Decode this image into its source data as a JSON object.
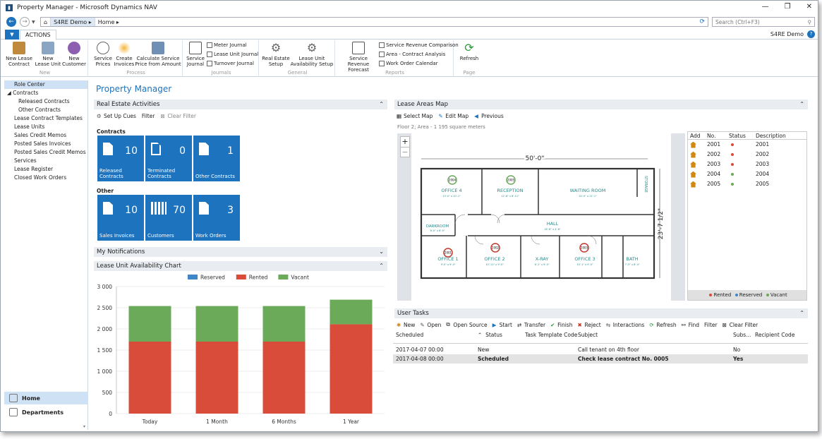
{
  "window": {
    "title": "Property Manager - Microsoft Dynamics NAV",
    "controls": [
      "—",
      "❐",
      "✕"
    ]
  },
  "nav": {
    "crumbs": [
      "S4RE Demo",
      "Home"
    ],
    "search_placeholder": "Search (Ctrl+F3)"
  },
  "ribbon": {
    "tab": "ACTIONS",
    "user": "S4RE Demo",
    "groups": [
      {
        "name": "New",
        "buttons": [
          {
            "label": "New Lease\nContract"
          },
          {
            "label": "New\nLease Unit"
          },
          {
            "label": "New\nCustomer"
          }
        ]
      },
      {
        "name": "Process",
        "buttons": [
          {
            "label": "Service\nPrices"
          },
          {
            "label": "Create\nInvoices"
          },
          {
            "label": "Calculate Service\nPrice from Amount"
          }
        ]
      },
      {
        "name": "Journals",
        "buttons": [
          {
            "label": "Service\nJournal"
          }
        ],
        "small": [
          "Meter Journal",
          "Lease Unit Journal",
          "Turnover Journal"
        ]
      },
      {
        "name": "General",
        "buttons": [
          {
            "label": "Real Estate\nSetup"
          },
          {
            "label": "Lease Unit\nAvailability Setup"
          }
        ]
      },
      {
        "name": "Reports",
        "buttons": [
          {
            "label": "Service Revenue\nForecast"
          }
        ],
        "small": [
          "Service Revenue Comparison",
          "Area - Contract Analysis",
          "Work Order Calendar"
        ]
      },
      {
        "name": "Page",
        "buttons": [
          {
            "label": "Refresh"
          }
        ]
      }
    ]
  },
  "sidebar": {
    "items": [
      "Role Center",
      "Contracts",
      "Released Contracts",
      "Other Contracts",
      "Lease Contract Templates",
      "Lease Units",
      "Sales Credit Memos",
      "Posted Sales Invoices",
      "Posted Sales Credit Memos",
      "Services",
      "Lease Register",
      "Closed Work Orders"
    ],
    "bottom": [
      "Home",
      "Departments"
    ]
  },
  "page": {
    "title": "Property Manager"
  },
  "activities": {
    "header": "Real Estate Activities",
    "actions": [
      "Set Up Cues",
      "Filter",
      "Clear Filter"
    ],
    "group1": "Contracts",
    "group2": "Other",
    "tiles1": [
      {
        "num": "10",
        "label": "Released\nContracts"
      },
      {
        "num": "0",
        "label": "Terminated\nContracts"
      },
      {
        "num": "1",
        "label": "Other Contracts"
      }
    ],
    "tiles2": [
      {
        "num": "10",
        "label": "Sales Invoices"
      },
      {
        "num": "70",
        "label": "Customers"
      },
      {
        "num": "3",
        "label": "Work Orders"
      }
    ]
  },
  "notifications": {
    "header": "My Notifications"
  },
  "chart_data": {
    "type": "bar",
    "title": "Lease Unit Availability Chart",
    "categories": [
      "Today",
      "1 Month",
      "6 Months",
      "1 Year"
    ],
    "series": [
      {
        "name": "Reserved",
        "color": "#3e86c8",
        "values": [
          0,
          0,
          0,
          0
        ]
      },
      {
        "name": "Rented",
        "color": "#d94c3a",
        "values": [
          1700,
          1700,
          1700,
          2110
        ]
      },
      {
        "name": "Vacant",
        "color": "#6aaa58",
        "values": [
          840,
          840,
          840,
          580
        ]
      }
    ],
    "ylim": [
      0,
      3000
    ],
    "yticks": [
      "0",
      "500",
      "1 000",
      "1 500",
      "2 000",
      "2 500",
      "3 000"
    ],
    "legend": "top",
    "grid": true
  },
  "map": {
    "header": "Lease Areas Map",
    "actions": [
      "Select Map",
      "Edit Map",
      "Previous"
    ],
    "info": "Floor 2; Area - 1 195 square meters",
    "dim_top": "50'-0\"",
    "dim_side": "23'-7 1/2\"",
    "rooms": [
      {
        "name": "OFFICE 4",
        "size": "13'-0\" x 10'-1\""
      },
      {
        "name": "RECEPTION",
        "size": "12'-6\" x 8'-11\""
      },
      {
        "name": "WAITING ROOM",
        "size": "20'-0\" x 11'-1\""
      },
      {
        "name": "DARKROOM",
        "size": "6'-0\" x 8'-0\""
      },
      {
        "name": "HALL",
        "size": "45'-6\" x 4'-6\""
      },
      {
        "name": "OFFICE 1",
        "size": "9'-0\" x 9'-0\""
      },
      {
        "name": "OFFICE 2",
        "size": "10'-11\" x 9'-0\""
      },
      {
        "name": "X-RAY",
        "size": "8'-1\" x 9'-0\""
      },
      {
        "name": "OFFICE 3",
        "size": "10'-1\" x 9'-0\""
      },
      {
        "name": "BATH",
        "size": "7'-5\" x 8'-4\""
      },
      {
        "name": "STORAGE",
        "size": ""
      }
    ],
    "markers": [
      "2004",
      "2001",
      "2002",
      "2003",
      "2005"
    ],
    "grid": {
      "headers": [
        "Add",
        "No.",
        "Status",
        "Description"
      ],
      "rows": [
        {
          "no": "2001",
          "status": "#d94c3a",
          "desc": "2001"
        },
        {
          "no": "2002",
          "status": "#d94c3a",
          "desc": "2002"
        },
        {
          "no": "2003",
          "status": "#d94c3a",
          "desc": "2003"
        },
        {
          "no": "2004",
          "status": "#6aaa58",
          "desc": "2004"
        },
        {
          "no": "2005",
          "status": "#6aaa58",
          "desc": "2005"
        }
      ]
    },
    "legend": [
      "Rented",
      "Reserved",
      "Vacant"
    ]
  },
  "tasks": {
    "header": "User Tasks",
    "actions": [
      "New",
      "Open",
      "Open Source",
      "Start",
      "Transfer",
      "Finish",
      "Reject",
      "Interactions",
      "Refresh",
      "Find",
      "Filter",
      "Clear Filter"
    ],
    "columns": [
      "Scheduled",
      "Status",
      "Task Template Code",
      "Subject",
      "Subs...",
      "Recipient Code"
    ],
    "rows": [
      {
        "scheduled": "2017-04-07 00:00",
        "status": "New",
        "tpl": "",
        "subject": "Call tenant on 4th floor",
        "subs": "No",
        "rc": ""
      },
      {
        "scheduled": "2017-04-08 00:00",
        "status": "Scheduled",
        "tpl": "",
        "subject": "Check lease contract No. 0005",
        "subs": "Yes",
        "rc": ""
      }
    ]
  }
}
